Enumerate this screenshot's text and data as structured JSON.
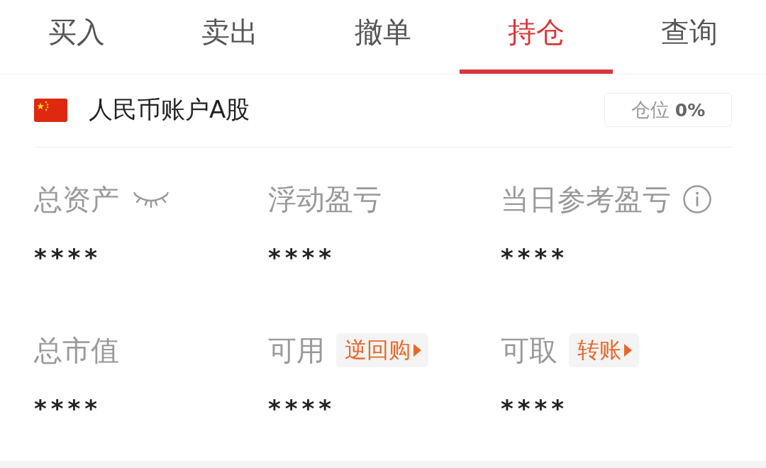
{
  "tabs": [
    {
      "label": "买入",
      "selected": false
    },
    {
      "label": "卖出",
      "selected": false
    },
    {
      "label": "撤单",
      "selected": false
    },
    {
      "label": "持仓",
      "selected": true
    },
    {
      "label": "查询",
      "selected": false
    }
  ],
  "account": {
    "name": "人民币账户A股",
    "position_label": "仓位",
    "position_value": "0%"
  },
  "stats": [
    {
      "kind": "eye",
      "label": "总资产",
      "value": "****"
    },
    {
      "kind": "plain",
      "label": "浮动盈亏",
      "value": "****"
    },
    {
      "kind": "info",
      "label": "当日参考盈亏",
      "value": "****"
    },
    {
      "kind": "plain",
      "label": "总市值",
      "value": "****"
    },
    {
      "kind": "action",
      "label": "可用",
      "action": "逆回购",
      "value": "****"
    },
    {
      "kind": "action",
      "label": "可取",
      "action": "转账",
      "value": "****"
    }
  ]
}
